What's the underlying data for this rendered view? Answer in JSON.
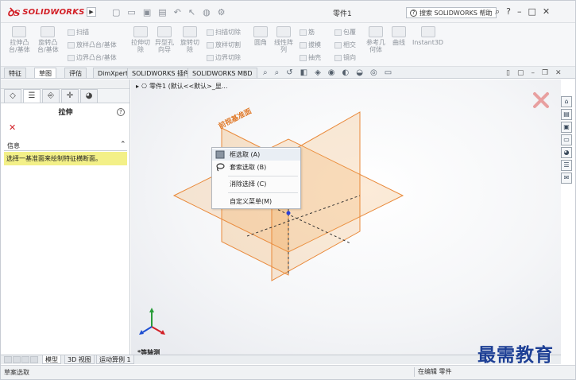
{
  "app": {
    "logo_text": "SOLIDWORKS",
    "document_title": "零件1",
    "help_search": "搜索 SOLIDWORKS 帮助"
  },
  "ribbon": {
    "groups": [
      {
        "label": "拉伸凸\n台/基体"
      },
      {
        "label": "旋转凸\n台/基体"
      },
      {
        "label": "拉伸切\n除"
      },
      {
        "label": "异型孔\n向导"
      },
      {
        "label": "旋转切\n除"
      },
      {
        "label": "圆角"
      },
      {
        "label": "线性阵\n列"
      },
      {
        "label": "参考几\n何体"
      },
      {
        "label": "曲线"
      },
      {
        "label": "Instant3D"
      }
    ],
    "small_items": [
      "扫描",
      "放样凸台/基体",
      "边界凸台/基体",
      "扫描切除",
      "放样切割",
      "边界切除",
      "筋",
      "拔模",
      "抽壳",
      "包覆",
      "相交",
      "镜向"
    ]
  },
  "tabs": [
    {
      "label": "特征",
      "active": false
    },
    {
      "label": "草图",
      "active": true
    },
    {
      "label": "评估",
      "active": false
    },
    {
      "label": "DimXpert",
      "active": false
    },
    {
      "label": "SOLIDWORKS 插件",
      "active": false
    },
    {
      "label": "SOLIDWORKS MBD",
      "active": false
    }
  ],
  "property_manager": {
    "title": "拉伸",
    "info_header": "信息",
    "info_message": "选择一基准面来绘制特征横断面。"
  },
  "breadcrumb": {
    "text": "零件1 (默认<<默认>_显..."
  },
  "context_menu": {
    "items": [
      {
        "label": "框选取 (A)"
      },
      {
        "label": "套索选取 (B)"
      },
      {
        "label": "消除选择 (C)"
      },
      {
        "label": "自定义菜单(M)"
      }
    ]
  },
  "plane_label": "前视基准面",
  "view_label": "*等轴测",
  "bottom_tabs": [
    {
      "label": "模型",
      "active": true
    },
    {
      "label": "3D 视图",
      "active": false
    },
    {
      "label": "运动算例 1",
      "active": false
    }
  ],
  "status": {
    "left": "草案选取",
    "right": "在编辑 零件"
  },
  "watermark": "最需教育",
  "colors": {
    "brand": "#d21f26",
    "plane_fill": "#f2a64f",
    "plane_stroke": "#e9893a",
    "info_bg": "#f3f088",
    "watermark": "#1d3f95"
  }
}
